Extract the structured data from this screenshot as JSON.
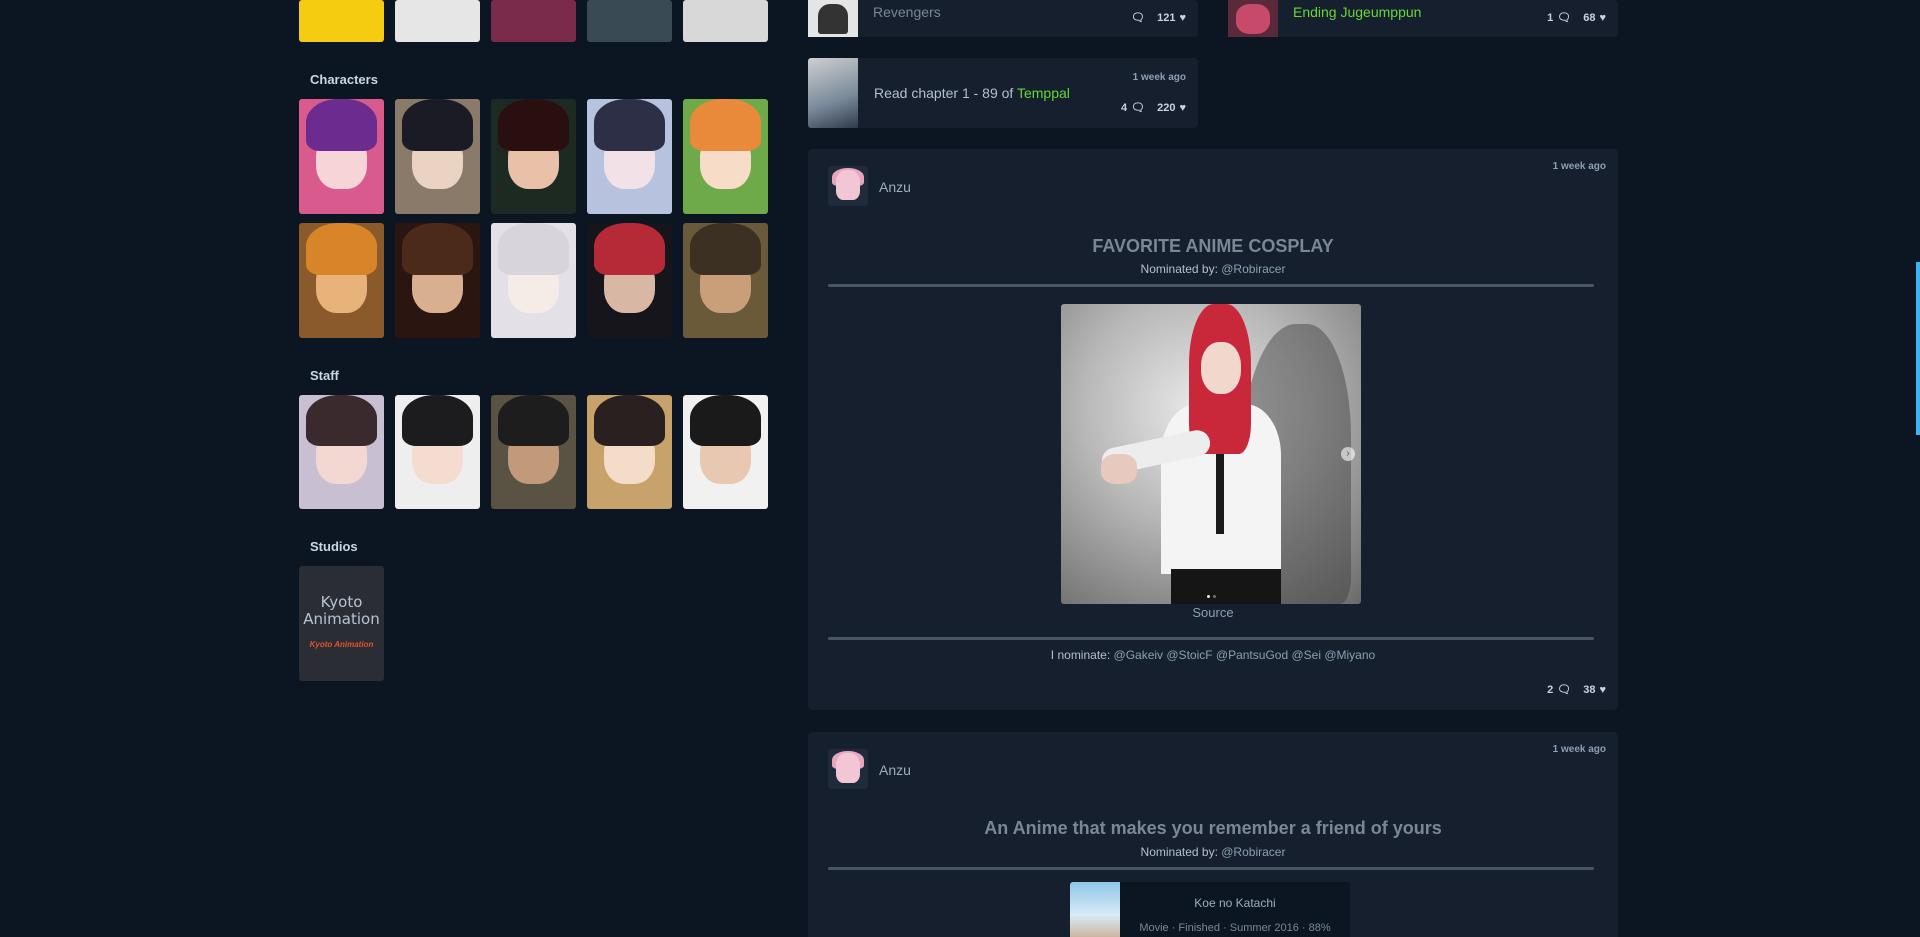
{
  "left": {
    "top_row_colors": [
      "#f5cc10",
      "#e6e6e6",
      "#7a2a4a",
      "#3a4a55",
      "#d8d8d8"
    ],
    "characters_title": "Characters",
    "characters": [
      {
        "bg": "#d95a8c",
        "hair": "#6b2b8f",
        "face": "#f6d4d8"
      },
      {
        "bg": "#8a7a6a",
        "hair": "#1b1b25",
        "face": "#ead3c2"
      },
      {
        "bg": "#1d2a22",
        "hair": "#2a0f10",
        "face": "#e8c1a8"
      },
      {
        "bg": "#b7c2de",
        "hair": "#2d2f47",
        "face": "#f2e1e6"
      },
      {
        "bg": "#6faa4a",
        "hair": "#e88a3a",
        "face": "#f7dcc7"
      },
      {
        "bg": "#8a5a2a",
        "hair": "#d8852a",
        "face": "#e8b37a"
      },
      {
        "bg": "#2a1510",
        "hair": "#4b2a1a",
        "face": "#d8b090"
      },
      {
        "bg": "#e3e0e8",
        "hair": "#d8d4dc",
        "face": "#f5ece8"
      },
      {
        "bg": "#15151b",
        "hair": "#b52a36",
        "face": "#d8b8a5"
      },
      {
        "bg": "#6b5a3a",
        "hair": "#3b3022",
        "face": "#c99f7a"
      }
    ],
    "staff_title": "Staff",
    "staff": [
      {
        "bg": "#c8c0d2",
        "hair": "#3a2a2e",
        "face": "#f2d8d0"
      },
      {
        "bg": "#eeeeee",
        "hair": "#1c1c1f",
        "face": "#f4ddd0"
      },
      {
        "bg": "#5a5242",
        "hair": "#1d1d1d",
        "face": "#c29a7a"
      },
      {
        "bg": "#c7a26a",
        "hair": "#2a2020",
        "face": "#f3dcc8"
      },
      {
        "bg": "#f1f1f1",
        "hair": "#1a1a1a",
        "face": "#e8c8b0"
      }
    ],
    "studios_title": "Studios",
    "studio": {
      "name": "Kyoto Animation",
      "logo_text": "Kyoto Animation"
    }
  },
  "activity": {
    "top_left": {
      "text": "Revengers",
      "comments": "",
      "likes": "121"
    },
    "top_right": {
      "link": "Ending Jugeumppun",
      "comments": "1",
      "likes": "68"
    },
    "manga": {
      "time": "1 week ago",
      "prefix": "Read chapter 1 - 89 of",
      "link": "Temppal",
      "comments": "4",
      "likes": "220"
    }
  },
  "posts": [
    {
      "user": "Anzu",
      "time": "1 week ago",
      "title": "FAVORITE ANIME COSPLAY",
      "nominated_label": "Nominated by:",
      "nominated_user": "@Robiracer",
      "source": "Source",
      "nominate_label": "I nominate:",
      "nominate_users": "@Gakeiv @StoicF @PantsuGod @Sei @Miyano",
      "comments": "2",
      "likes": "38"
    },
    {
      "user": "Anzu",
      "time": "1 week ago",
      "title": "An Anime that makes you remember a friend of yours",
      "nominated_label": "Nominated by:",
      "nominated_user": "@Robiracer",
      "media_title": "Koe no Katachi",
      "media_meta": "Movie · Finished · Summer 2016 · 88%"
    }
  ],
  "icons": {
    "comment": "comments-icon",
    "like": "heart-icon",
    "next": "chevron-right-icon"
  },
  "colors": {
    "background": "#0b1622",
    "card": "#151f2e",
    "link": "#68d639",
    "accent": "#3db4f2"
  }
}
